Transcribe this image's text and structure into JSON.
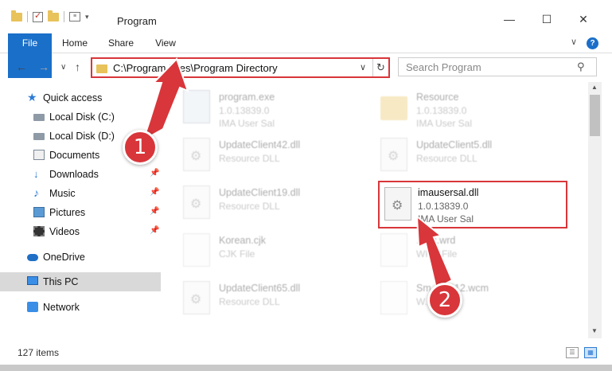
{
  "window": {
    "title": "Program",
    "minimize_glyph": "—",
    "maximize_glyph": "☐",
    "close_glyph": "✕"
  },
  "ribbon": {
    "tabs": [
      {
        "label": "File"
      },
      {
        "label": "Home"
      },
      {
        "label": "Share"
      },
      {
        "label": "View"
      }
    ],
    "expand_glyph": "∨",
    "help_glyph": "?"
  },
  "nav": {
    "back_glyph": "←",
    "forward_glyph": "→",
    "recent_glyph": "∨",
    "up_glyph": "↑"
  },
  "address": {
    "path": "C:\\Program Files\\Program Directory",
    "dropdown_glyph": "∨",
    "refresh_glyph": "↻"
  },
  "search": {
    "placeholder": "Search Program",
    "icon_glyph": "⚲"
  },
  "sidebar": {
    "pin_glyph": "📌",
    "items": [
      {
        "label": "Quick access",
        "glyph": "★"
      },
      {
        "label": "Local Disk (C:)",
        "glyph": ""
      },
      {
        "label": "Local Disk (D:)",
        "glyph": ""
      },
      {
        "label": "Documents",
        "glyph": ""
      },
      {
        "label": "Downloads",
        "glyph": "↓"
      },
      {
        "label": "Music",
        "glyph": "♪"
      },
      {
        "label": "Pictures",
        "glyph": ""
      },
      {
        "label": "Videos",
        "glyph": ""
      },
      {
        "label": "OneDrive",
        "glyph": ""
      },
      {
        "label": "This PC",
        "glyph": ""
      },
      {
        "label": "Network",
        "glyph": ""
      }
    ]
  },
  "files": [
    {
      "name": "program.exe",
      "line2": "1.0.13839.0",
      "line3": "IMA User Sal"
    },
    {
      "name": "Resource",
      "line2": "1.0.13839.0",
      "line3": "IMA User Sal"
    },
    {
      "name": "UpdateClient42.dll",
      "line2": "Resource DLL",
      "line3": ""
    },
    {
      "name": "UpdateClient5.dll",
      "line2": "Resource DLL",
      "line3": ""
    },
    {
      "name": "UpdateClient19.dll",
      "line2": "Resource DLL",
      "line3": ""
    },
    {
      "name": "imausersal.dll",
      "line2": "1.0.13839.0",
      "line3": "IMA User Sal"
    },
    {
      "name": "Korean.cjk",
      "line2": "CJK File",
      "line3": ""
    },
    {
      "name": "...sic.wrd",
      "line2": "WRD File",
      "line3": ""
    },
    {
      "name": "UpdateClient65.dll",
      "line2": "Resource DLL",
      "line3": ""
    },
    {
      "name": "Sm...MP12.wcm",
      "line2": "W...",
      "line3": ""
    }
  ],
  "scrollbar": {
    "up_glyph": "▲",
    "down_glyph": "▼"
  },
  "status": {
    "item_count": "127 items",
    "details_view_glyph": "☰",
    "tiles_view_glyph": "▦"
  },
  "annotations": [
    {
      "label": "1"
    },
    {
      "label": "2"
    }
  ],
  "colors": {
    "accent": "#1a6fc9",
    "highlight_red": "#d8363a",
    "folder": "#e8c25a",
    "selected_bg": "#d9d9d9"
  }
}
